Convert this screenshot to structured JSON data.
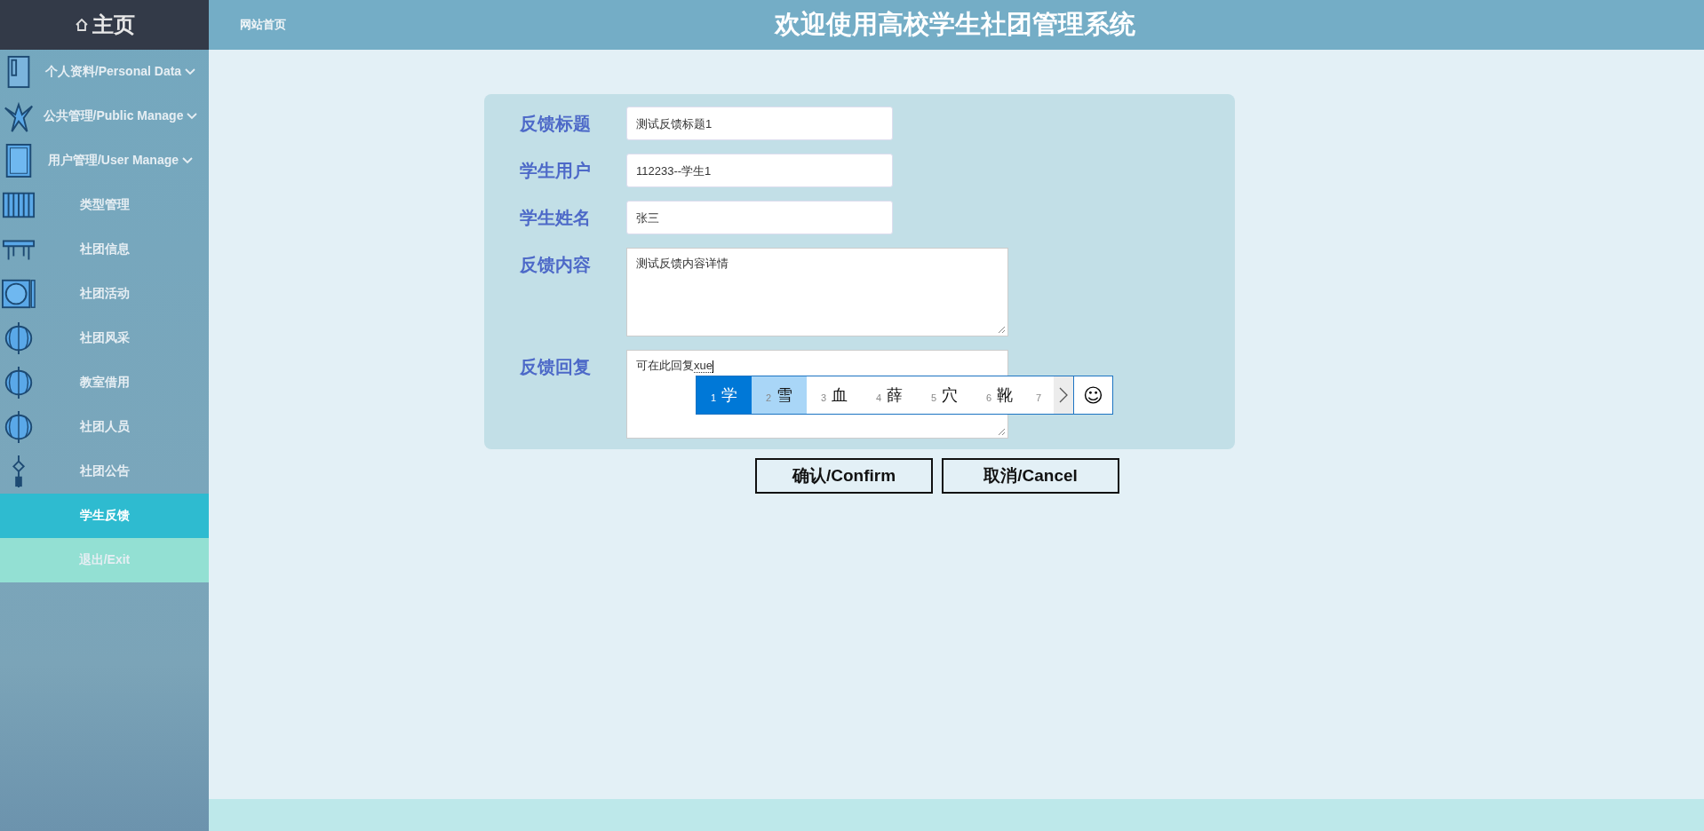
{
  "sidebar": {
    "home": "主页",
    "items": [
      {
        "kind": "group",
        "label": "个人资料/Personal Data",
        "selected": false
      },
      {
        "kind": "group",
        "label": "公共管理/Public Manage",
        "selected": false
      },
      {
        "kind": "group",
        "label": "用户管理/User Manage",
        "selected": false
      },
      {
        "kind": "item",
        "label": "类型管理",
        "selected": false
      },
      {
        "kind": "item",
        "label": "社团信息",
        "selected": false
      },
      {
        "kind": "item",
        "label": "社团活动",
        "selected": false
      },
      {
        "kind": "item",
        "label": "社团风采",
        "selected": false
      },
      {
        "kind": "item",
        "label": "教室借用",
        "selected": false
      },
      {
        "kind": "item",
        "label": "社团人员",
        "selected": false
      },
      {
        "kind": "item",
        "label": "社团公告",
        "selected": false
      },
      {
        "kind": "plain",
        "label": "学生反馈",
        "selected": true
      },
      {
        "kind": "exit",
        "label": "退出/Exit",
        "selected": false
      }
    ]
  },
  "header": {
    "link": "网站首页",
    "title": "欢迎使用高校学生社团管理系统"
  },
  "form": {
    "fields": [
      {
        "kind": "input",
        "label": "反馈标题",
        "value": "测试反馈标题1"
      },
      {
        "kind": "input",
        "label": "学生用户",
        "value": "112233--学生1"
      },
      {
        "kind": "input",
        "label": "学生姓名",
        "value": "张三"
      },
      {
        "kind": "textarea",
        "label": "反馈内容",
        "value": "测试反馈内容详情"
      },
      {
        "kind": "textarea",
        "label": "反馈回复",
        "value": "可在此回复",
        "composing": "xue"
      }
    ],
    "buttons": [
      "确认/Confirm",
      "取消/Cancel"
    ]
  },
  "ime": {
    "candidates": [
      {
        "number": "1",
        "char": "学",
        "selected": true,
        "highlighted": false
      },
      {
        "number": "2",
        "char": "雪",
        "selected": false,
        "highlighted": true
      },
      {
        "number": "3",
        "char": "血",
        "selected": false,
        "highlighted": false
      },
      {
        "number": "4",
        "char": "薛",
        "selected": false,
        "highlighted": false
      },
      {
        "number": "5",
        "char": "穴",
        "selected": false,
        "highlighted": false
      },
      {
        "number": "6",
        "char": "靴",
        "selected": false,
        "highlighted": false
      },
      {
        "number": "7",
        "selected": false,
        "highlighted": false
      }
    ],
    "emoji": "☺"
  }
}
